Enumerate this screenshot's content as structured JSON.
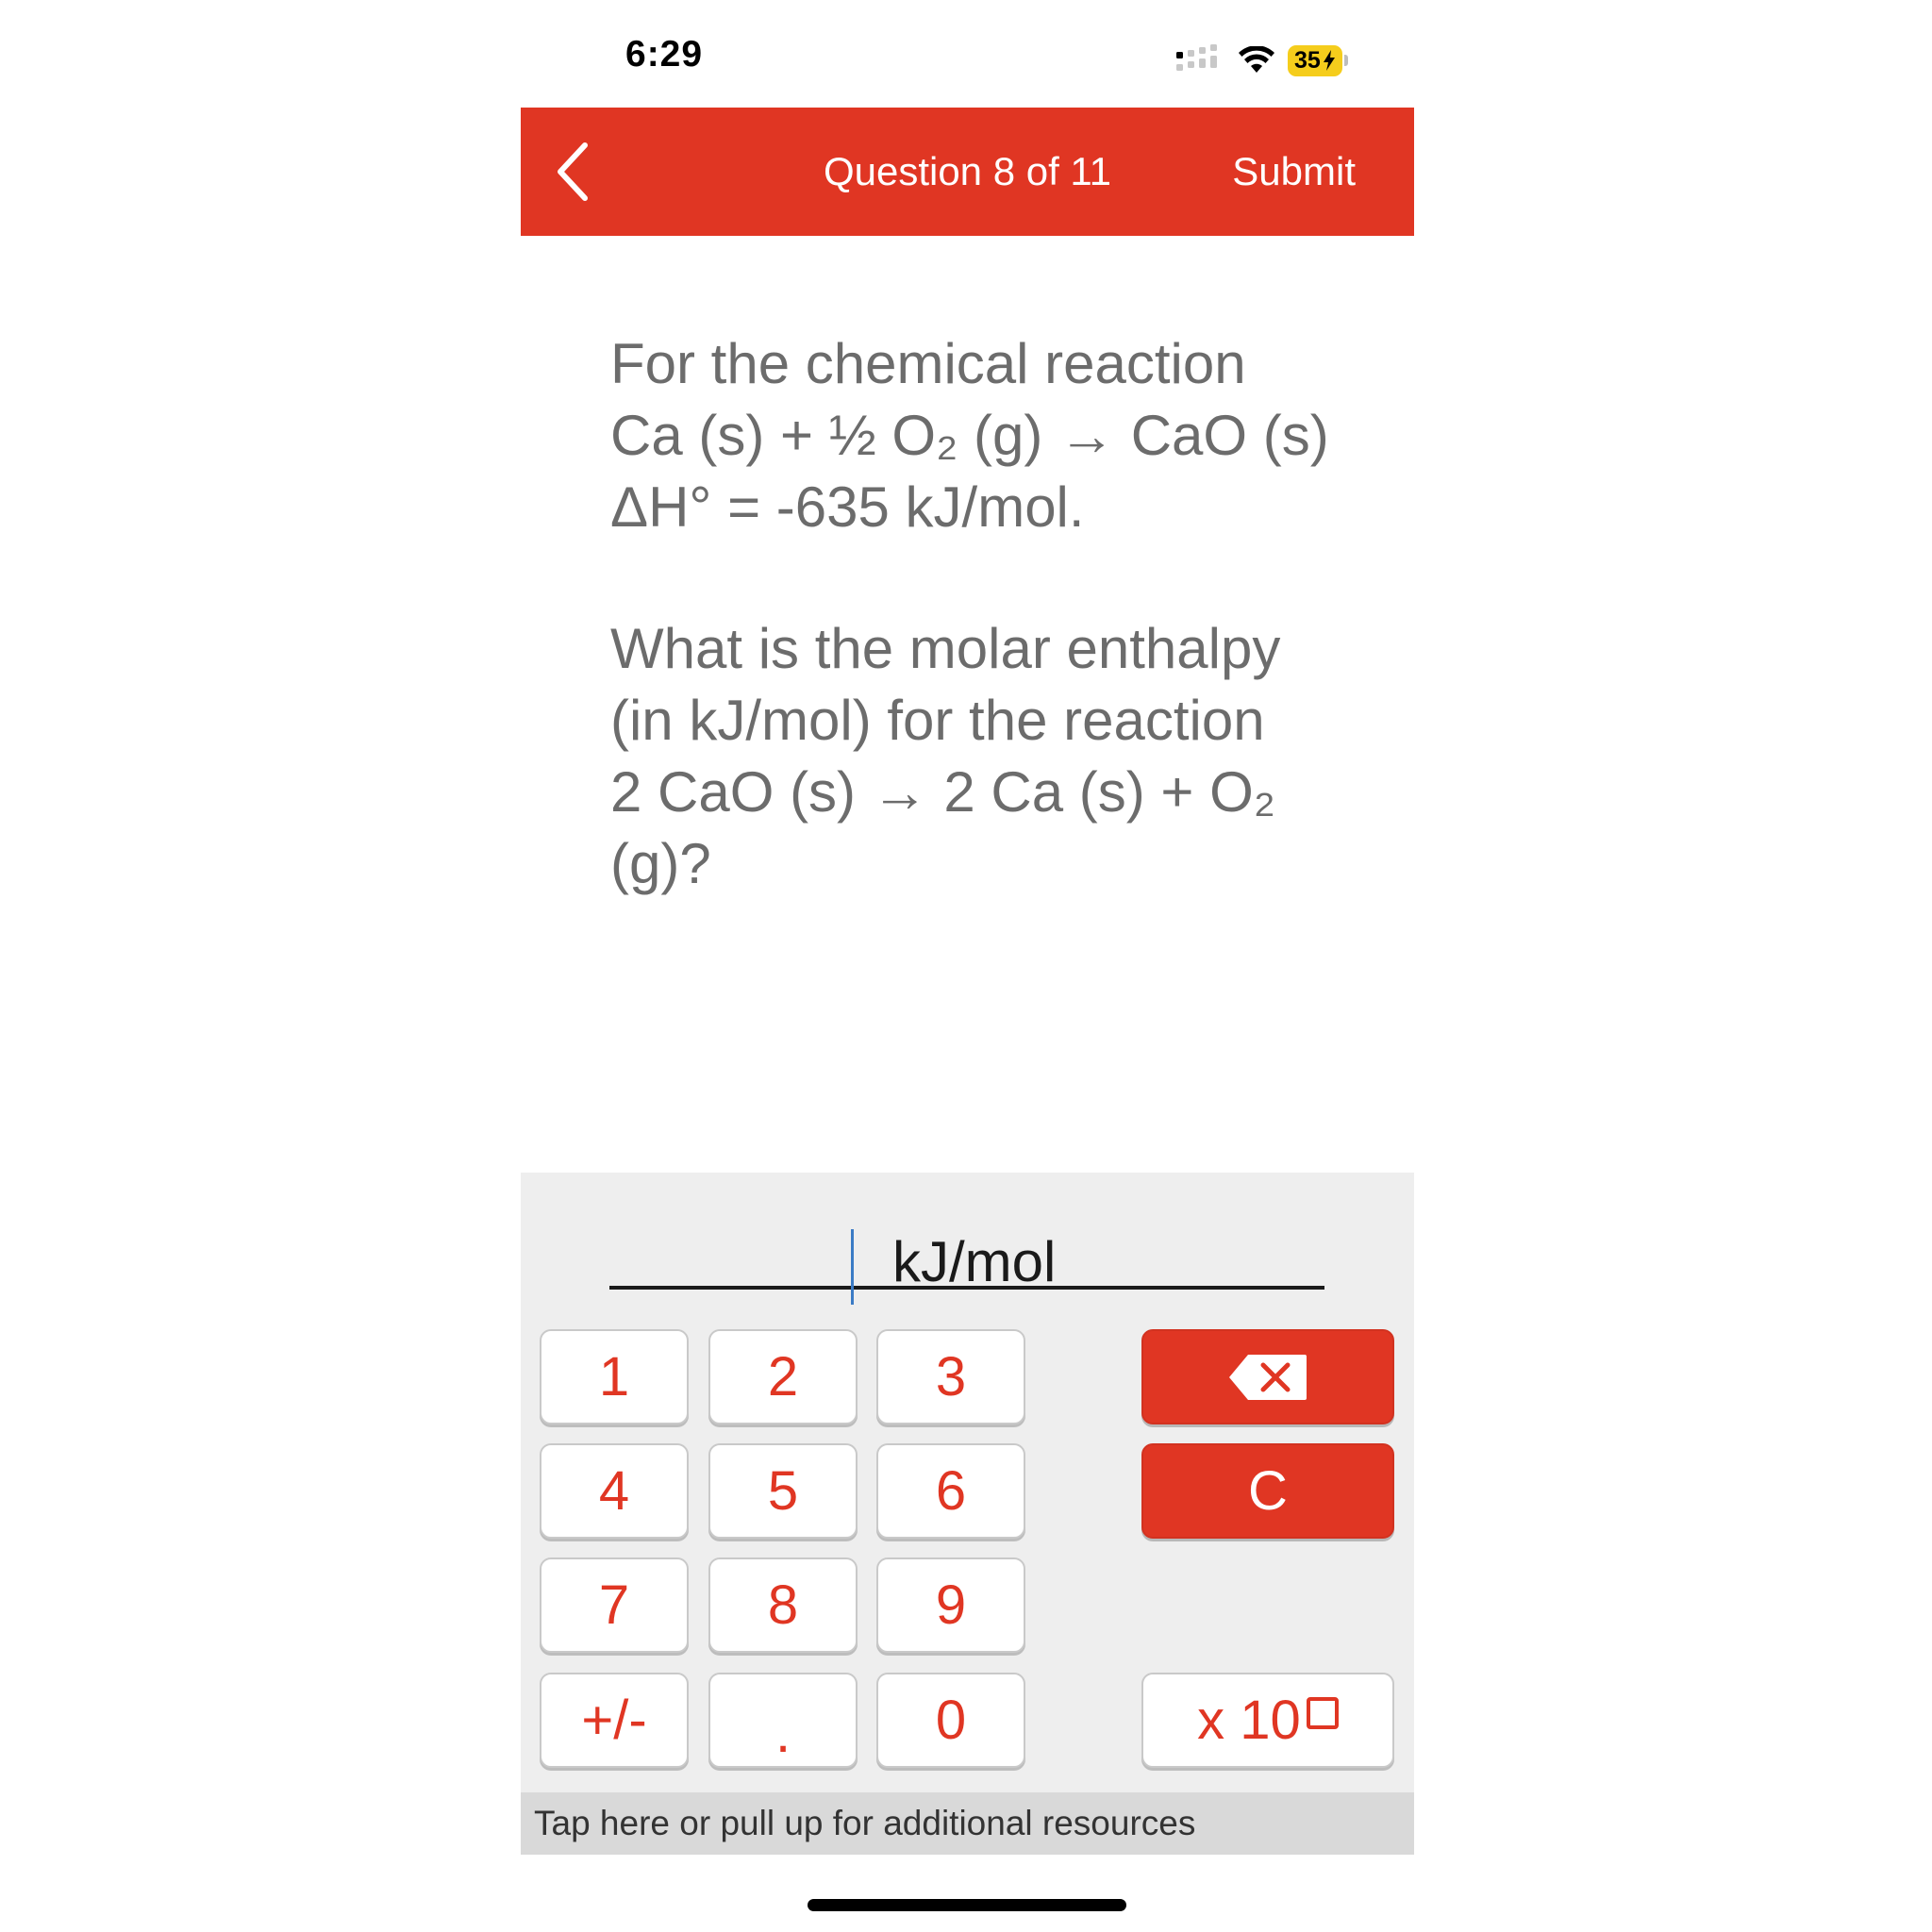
{
  "status_bar": {
    "time": "6:29",
    "battery_level": "35"
  },
  "header": {
    "title": "Question 8 of 11",
    "submit_label": "Submit",
    "background_color": "#e03623"
  },
  "question": {
    "intro_lines": [
      "For the chemical reaction",
      "Ca (s) + ½ O₂ (g) → CaO (s)",
      "ΔH° = -635 kJ/mol."
    ],
    "prompt_lines": [
      "What is the molar enthalpy",
      "(in kJ/mol) for the reaction",
      "2 CaO (s) → 2 Ca (s) + O₂",
      "(g)?"
    ]
  },
  "answer": {
    "value": "",
    "unit": "kJ/mol"
  },
  "keypad": {
    "keys": [
      "1",
      "2",
      "3",
      "4",
      "5",
      "6",
      "7",
      "8",
      "9",
      "+/-",
      ".",
      "0"
    ],
    "clear_label": "C",
    "x10_label": "x 10",
    "accent_color": "#e03623"
  },
  "footer": {
    "resources_label": "Tap here or pull up for additional resources"
  }
}
